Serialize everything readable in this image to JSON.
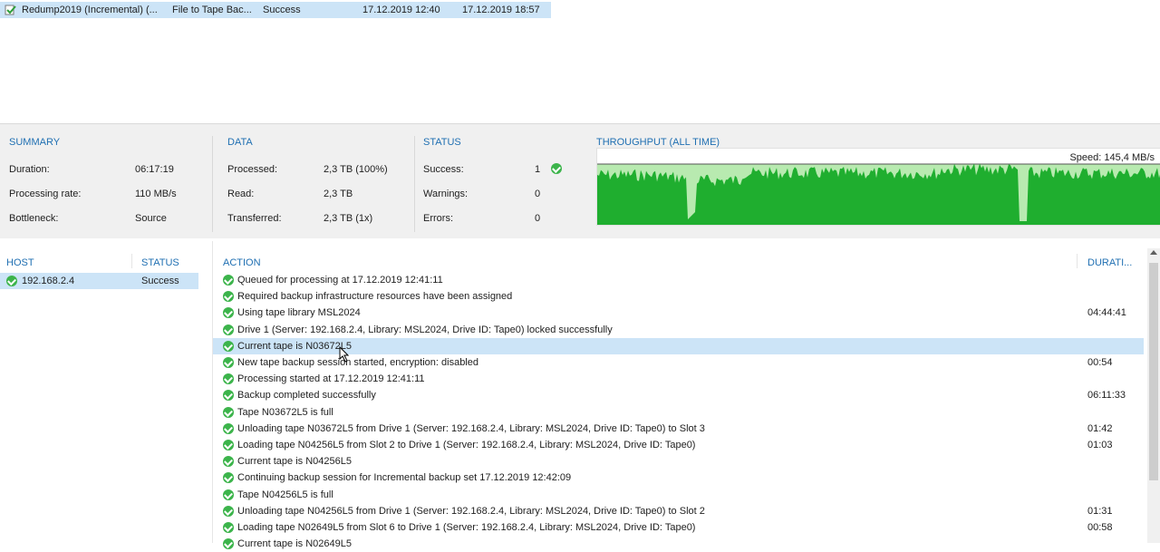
{
  "job": {
    "name": "Redump2019 (Incremental) (...",
    "type": "File to Tape Bac...",
    "status": "Success",
    "start": "17.12.2019 12:40",
    "end": "17.12.2019 18:57"
  },
  "summary": {
    "header": "SUMMARY",
    "duration_label": "Duration:",
    "duration": "06:17:19",
    "rate_label": "Processing rate:",
    "rate": "110 MB/s",
    "bottleneck_label": "Bottleneck:",
    "bottleneck": "Source"
  },
  "data": {
    "header": "DATA",
    "processed_label": "Processed:",
    "processed": "2,3 TB (100%)",
    "read_label": "Read:",
    "read": "2,3 TB",
    "transferred_label": "Transferred:",
    "transferred": "2,3 TB (1x)"
  },
  "status": {
    "header": "STATUS",
    "success_label": "Success:",
    "success": "1",
    "warnings_label": "Warnings:",
    "warnings": "0",
    "errors_label": "Errors:",
    "errors": "0"
  },
  "throughput": {
    "header": "THROUGHPUT (ALL TIME)",
    "speed": "Speed: 145,4 MB/s",
    "fill_color": "#1fae2f",
    "bg_color": "#b8eab0"
  },
  "host_pane": {
    "col_host": "HOST",
    "col_status": "STATUS",
    "rows": [
      {
        "host": "192.168.2.4",
        "status": "Success"
      }
    ]
  },
  "action_pane": {
    "col_action": "ACTION",
    "col_duration": "DURATI...",
    "rows": [
      {
        "text": "Queued for processing at 17.12.2019 12:41:11",
        "duration": ""
      },
      {
        "text": "Required backup infrastructure resources have been assigned",
        "duration": ""
      },
      {
        "text": "Using tape library MSL2024",
        "duration": "04:44:41"
      },
      {
        "text": "Drive 1 (Server: 192.168.2.4, Library: MSL2024, Drive ID: Tape0) locked successfully",
        "duration": ""
      },
      {
        "text": "Current tape is N03672L5",
        "duration": ""
      },
      {
        "text": "New tape backup session started, encryption: disabled",
        "duration": "00:54"
      },
      {
        "text": "Processing started at 17.12.2019 12:41:11",
        "duration": ""
      },
      {
        "text": "Backup completed successfully",
        "duration": "06:11:33"
      },
      {
        "text": "Tape N03672L5 is full",
        "duration": ""
      },
      {
        "text": "Unloading tape N03672L5 from Drive 1 (Server: 192.168.2.4, Library: MSL2024, Drive ID: Tape0) to Slot 3",
        "duration": "01:42"
      },
      {
        "text": "Loading tape N04256L5 from Slot 2 to Drive 1 (Server: 192.168.2.4, Library: MSL2024, Drive ID: Tape0)",
        "duration": "01:03"
      },
      {
        "text": "Current tape is N04256L5",
        "duration": ""
      },
      {
        "text": "Continuing backup session for Incremental backup set 17.12.2019 12:42:09",
        "duration": ""
      },
      {
        "text": "Tape N04256L5 is full",
        "duration": ""
      },
      {
        "text": "Unloading tape N04256L5 from Drive 1 (Server: 192.168.2.4, Library: MSL2024, Drive ID: Tape0) to Slot 2",
        "duration": "01:31"
      },
      {
        "text": "Loading tape N02649L5 from Slot 6 to Drive 1 (Server: 192.168.2.4, Library: MSL2024, Drive ID: Tape0)",
        "duration": "00:58"
      },
      {
        "text": "Current tape is N02649L5",
        "duration": ""
      }
    ]
  }
}
